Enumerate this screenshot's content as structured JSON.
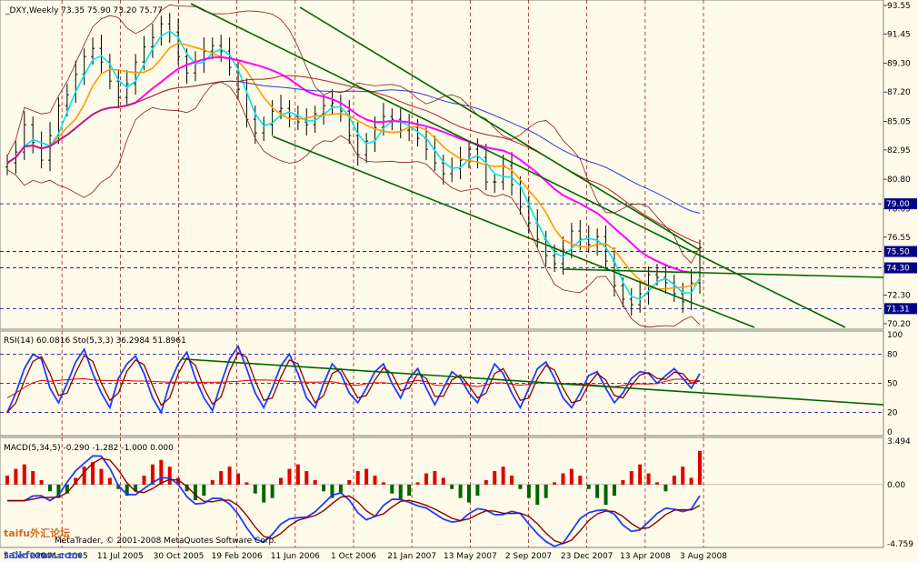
{
  "chart_data": {
    "type": "line",
    "subtype": "candlestick-with-indicators",
    "title": "_DXY,Weekly  73.35 75.90 73.20 75.77",
    "symbol": "_DXY",
    "timeframe": "Weekly",
    "last_bar": {
      "open": 73.35,
      "high": 75.9,
      "low": 73.2,
      "close": 75.77
    },
    "x_tick_labels": [
      "5 Dec 2004",
      "20 Mar 2005",
      "11 Jul 2005",
      "30 Oct 2005",
      "19 Feb 2006",
      "11 Jun 2006",
      "1 Oct 2006",
      "21 Jan 2007",
      "13 May 2007",
      "2 Sep 2007",
      "23 Dec 2007",
      "13 Apr 2008",
      "3 Aug 2008"
    ],
    "price_panel": {
      "ylim": [
        70.2,
        93.55
      ],
      "y_tick_labels": [
        "93.55",
        "91.45",
        "89.30",
        "87.20",
        "85.05",
        "82.95",
        "80.80",
        "78.65",
        "76.55",
        "74.40",
        "72.30",
        "70.20"
      ],
      "horizontal_level_tags": [
        {
          "label": "79.00",
          "value": 79.0
        },
        {
          "label": "75.50",
          "value": 75.5
        },
        {
          "label": "74.30",
          "value": 74.3
        },
        {
          "label": "71.31",
          "value": 71.31
        }
      ],
      "close_approx": [
        82.0,
        82.8,
        84.8,
        83.5,
        82.2,
        84.0,
        86.2,
        87.0,
        88.5,
        89.8,
        90.4,
        89.4,
        88.0,
        86.8,
        87.8,
        89.4,
        90.5,
        91.2,
        92.2,
        91.6,
        89.8,
        88.6,
        89.4,
        90.2,
        90.6,
        90.2,
        89.0,
        87.4,
        85.2,
        84.2,
        84.8,
        85.8,
        86.0,
        85.4,
        85.0,
        84.8,
        85.6,
        86.2,
        86.4,
        85.8,
        84.0,
        82.6,
        83.6,
        84.6,
        85.4,
        85.2,
        84.4,
        84.6,
        83.8,
        83.0,
        82.0,
        81.2,
        81.6,
        82.2,
        83.0,
        82.4,
        80.6,
        80.6,
        81.8,
        80.4,
        78.8,
        77.6,
        76.4,
        75.2,
        74.6,
        75.6,
        77.0,
        76.4,
        76.0,
        76.6,
        74.8,
        73.0,
        72.0,
        71.6,
        72.4,
        73.8,
        73.6,
        73.2,
        72.4,
        71.8,
        73.2,
        75.77
      ],
      "series": [
        {
          "name": "Price",
          "color": "#000000"
        },
        {
          "name": "MA fast",
          "color": "#00e5ee"
        },
        {
          "name": "MA medium",
          "color": "#ff9900"
        },
        {
          "name": "MA slow",
          "color": "#ff00ff"
        },
        {
          "name": "MA long",
          "color": "#2a3fd1"
        },
        {
          "name": "MA long 2",
          "color": "#b22222"
        },
        {
          "name": "Bollinger bands",
          "color": "#8b1a1a"
        }
      ]
    },
    "rsi_panel": {
      "label": "RSI(14) 60.0816  Sto(5,3,3) 36.2984 51.8961",
      "ylim": [
        0,
        100
      ],
      "y_tick_labels": [
        "100",
        "80",
        "50",
        "20",
        "0"
      ],
      "values_approx": [
        20,
        40,
        65,
        80,
        75,
        45,
        30,
        50,
        72,
        85,
        60,
        40,
        25,
        55,
        70,
        78,
        60,
        35,
        20,
        50,
        70,
        82,
        55,
        35,
        22,
        50,
        75,
        88,
        65,
        40,
        25,
        45,
        68,
        80,
        60,
        35,
        25,
        50,
        70,
        60,
        40,
        30,
        45,
        62,
        70,
        50,
        35,
        55,
        65,
        45,
        28,
        45,
        62,
        55,
        40,
        30,
        50,
        70,
        60,
        40,
        25,
        45,
        65,
        72,
        55,
        35,
        25,
        40,
        58,
        62,
        45,
        30,
        40,
        55,
        62,
        60,
        50,
        58,
        65,
        55,
        45,
        60
      ]
    },
    "macd_panel": {
      "label": "MACD(5,34,5) -0.290 -1.282 -1.000 0.000",
      "ylim": [
        -4.759,
        3.494
      ],
      "y_tick_labels": [
        "3.494",
        "0.00",
        "-4.759"
      ],
      "histogram_approx": [
        0.4,
        0.7,
        0.9,
        0.6,
        0.2,
        -0.3,
        -0.6,
        -0.4,
        0.3,
        0.8,
        1.0,
        0.7,
        0.3,
        -0.2,
        -0.5,
        -0.3,
        0.4,
        0.9,
        1.1,
        0.8,
        0.3,
        -0.3,
        -0.7,
        -0.5,
        0.2,
        0.6,
        0.8,
        0.5,
        0.1,
        -0.4,
        -0.8,
        -0.6,
        0.3,
        0.7,
        0.9,
        0.6,
        0.2,
        -0.3,
        -0.6,
        -0.4,
        0.2,
        0.6,
        0.7,
        0.4,
        0.1,
        -0.4,
        -0.7,
        -0.5,
        0.1,
        0.5,
        0.6,
        0.3,
        -0.2,
        -0.6,
        -0.8,
        -0.5,
        0.2,
        0.6,
        0.8,
        0.4,
        -0.2,
        -0.6,
        -0.9,
        -0.6,
        0.1,
        0.5,
        0.7,
        0.4,
        -0.2,
        -0.6,
        -0.9,
        -0.5,
        0.2,
        0.6,
        0.9,
        0.5,
        0.1,
        -0.3,
        0.4,
        0.8,
        0.3,
        1.5
      ]
    },
    "watermark": [
      "MetaTrader, © 2001-2008 MetaQuotes Software Corp.",
      "taifu外汇论坛",
      "talkforex.com"
    ]
  }
}
